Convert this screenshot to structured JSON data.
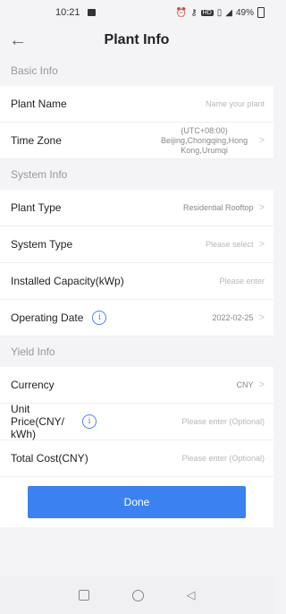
{
  "status_bar": {
    "time": "10:21",
    "battery": "49%"
  },
  "header": {
    "title": "Plant Info"
  },
  "sections": {
    "basic": "Basic Info",
    "system": "System Info",
    "yield": "Yield Info"
  },
  "fields": {
    "plant_name": {
      "label": "Plant Name",
      "placeholder": "Name your plant"
    },
    "time_zone": {
      "label": "Time Zone",
      "value_line1": "(UTC+08:00)",
      "value_line2": "Beijing,Chongqing,Hong",
      "value_line3": "Kong,Urumqi"
    },
    "plant_type": {
      "label": "Plant Type",
      "value": "Residential Rooftop"
    },
    "system_type": {
      "label": "System Type",
      "placeholder": "Please select"
    },
    "installed_capacity": {
      "label": "Installed Capacity(kWp)",
      "placeholder": "Please enter"
    },
    "operating_date": {
      "label": "Operating Date",
      "value": "2022-02-25"
    },
    "currency": {
      "label": "Currency",
      "value": "CNY"
    },
    "unit_price": {
      "label": "Unit Price(CNY/ kWh)",
      "placeholder": "Please enter (Optional)"
    },
    "total_cost": {
      "label": "Total Cost(CNY)",
      "placeholder": "Please enter (Optional)"
    }
  },
  "done_button": "Done",
  "colors": {
    "accent": "#3b82f0",
    "info_icon": "#4a84e8"
  }
}
